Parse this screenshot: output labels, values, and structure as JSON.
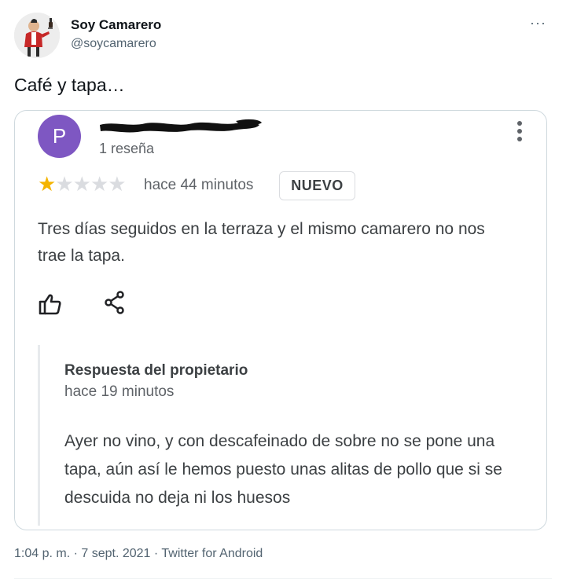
{
  "tweet": {
    "author_name": "Soy Camarero",
    "author_handle": "@soycamarero",
    "more_label": "···",
    "text": "Café y tapa…",
    "meta": "1:04 p. m. · 7 sept. 2021 · Twitter for Android"
  },
  "review": {
    "avatar_letter": "P",
    "reviewer_review_count": "1 reseña",
    "rating": 1,
    "max_rating": 5,
    "stars": [
      "★",
      "★",
      "★",
      "★",
      "★"
    ],
    "time": "hace 44 minutos",
    "badge": "NUEVO",
    "text": "Tres días seguidos en la terraza y el mismo camarero no nos trae la tapa.",
    "star_color": "#f4b400",
    "avatar_color": "#7e57c2"
  },
  "reply": {
    "title": "Respuesta del propietario",
    "time": "hace 19 minutos",
    "text": "Ayer no vino, y con descafeinado de sobre no se pone una tapa, aún así le hemos puesto unas alitas de pollo que si se descuida no deja ni los huesos"
  },
  "icons": {
    "like": "thumbs-up-icon",
    "share": "share-icon",
    "menu": "kebab-menu-icon"
  }
}
